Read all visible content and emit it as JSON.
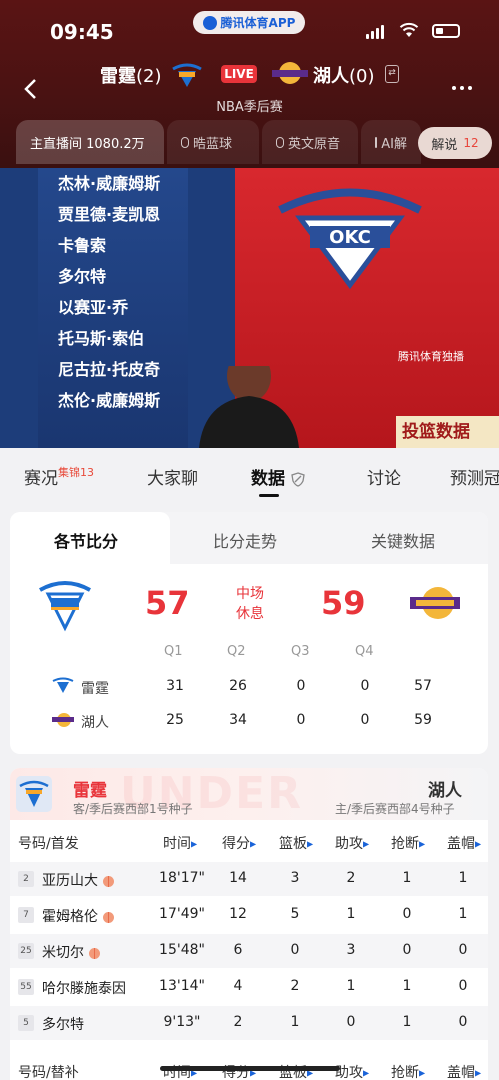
{
  "status": {
    "time": "09:45",
    "app_name": "腾讯体育APP"
  },
  "header": {
    "home_team": "雷霆",
    "home_wins": "(2)",
    "away_team": "湖人",
    "away_wins": "(0)",
    "live_label": "LIVE",
    "subtitle": "NBA季后赛",
    "audio_tabs": [
      {
        "label": "主直播间 1080.2万",
        "icon": ""
      },
      {
        "label": "晧蓝球",
        "icon": "mic-icon"
      },
      {
        "label": "英文原音",
        "icon": "mic-icon"
      },
      {
        "label": "AI解",
        "icon": "mic-icon"
      }
    ],
    "explain_label": "解说",
    "explain_count": "12"
  },
  "video": {
    "roster": [
      "杰林·威廉姆斯",
      "贾里德·麦凯恩",
      "卡鲁索",
      "多尔特",
      "以赛亚·乔",
      "托马斯·索伯",
      "尼古拉·托皮奇",
      "杰伦·威廉姆斯"
    ],
    "logo_text": "OKC",
    "watermark": "腾讯体育独播",
    "sign_text": "投篮数据"
  },
  "main_tabs": [
    {
      "label": "赛况",
      "sup": "集锦13"
    },
    {
      "label": "大家聊",
      "sup": ""
    },
    {
      "label": "数据",
      "sup": ""
    },
    {
      "label": "讨论",
      "sup": ""
    },
    {
      "label": "预测冠",
      "sup": ""
    }
  ],
  "score_card": {
    "subtabs": [
      "各节比分",
      "比分走势",
      "关键数据"
    ],
    "home_score": "57",
    "away_score": "59",
    "status_line1": "中场",
    "status_line2": "休息",
    "quarters": [
      "Q1",
      "Q2",
      "Q3",
      "Q4"
    ],
    "rows": [
      {
        "team": "雷霆",
        "q": [
          "31",
          "26",
          "0",
          "0"
        ],
        "total": "57"
      },
      {
        "team": "湖人",
        "q": [
          "25",
          "34",
          "0",
          "0"
        ],
        "total": "59"
      }
    ]
  },
  "box_score": {
    "home_team": "雷霆",
    "home_seed": "客/季后赛西部1号种子",
    "away_team": "湖人",
    "away_seed": "主/季后赛西部4号种子",
    "watermark": "UNDER",
    "starter_header": "号码/首发",
    "bench_header": "号码/替补",
    "columns": [
      "时间",
      "得分",
      "篮板",
      "助攻",
      "抢断",
      "盖帽"
    ],
    "starters": [
      {
        "num": "2",
        "name": "亚历山大",
        "time": "18'17\"",
        "pts": "14",
        "reb": "3",
        "ast": "2",
        "stl": "1",
        "blk": "1"
      },
      {
        "num": "7",
        "name": "霍姆格伦",
        "time": "17'49\"",
        "pts": "12",
        "reb": "5",
        "ast": "1",
        "stl": "0",
        "blk": "1"
      },
      {
        "num": "25",
        "name": "米切尔",
        "time": "15'48\"",
        "pts": "6",
        "reb": "0",
        "ast": "3",
        "stl": "0",
        "blk": "0"
      },
      {
        "num": "55",
        "name": "哈尔滕施泰因",
        "time": "13'14\"",
        "pts": "4",
        "reb": "2",
        "ast": "1",
        "stl": "1",
        "blk": "0"
      },
      {
        "num": "5",
        "name": "多尔特",
        "time": "9'13\"",
        "pts": "2",
        "reb": "1",
        "ast": "0",
        "stl": "1",
        "blk": "0"
      }
    ],
    "oncourt_marker": [
      true,
      true,
      true,
      false,
      false
    ]
  },
  "colors": {
    "accent": "#e8343a",
    "header_bg": "#4a1212",
    "link_blue": "#1a63d8"
  }
}
